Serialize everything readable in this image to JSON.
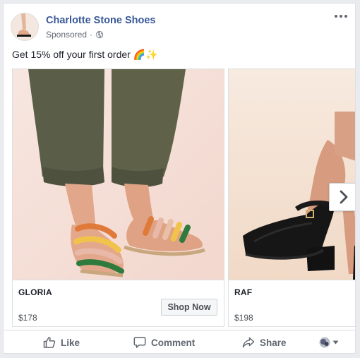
{
  "post": {
    "page_name": "Charlotte Stone Shoes",
    "sponsored_label": "Sponsored",
    "sponsored_separator": "·",
    "audience_icon": "globe-icon",
    "more_icon": "more-options-icon",
    "caption": "Get 15% off your first order 🌈✨"
  },
  "carousel": {
    "cards": [
      {
        "title": "GLORIA",
        "price": "$178",
        "cta": "Shop Now"
      },
      {
        "title": "RAF",
        "price": "$198"
      }
    ],
    "next_icon": "chevron-right-icon"
  },
  "actions": {
    "like": "Like",
    "comment": "Comment",
    "share": "Share"
  },
  "colors": {
    "link": "#385898",
    "text": "#1d2129",
    "secondary": "#606770",
    "border": "#dddfe2",
    "background": "#e9ebee"
  }
}
